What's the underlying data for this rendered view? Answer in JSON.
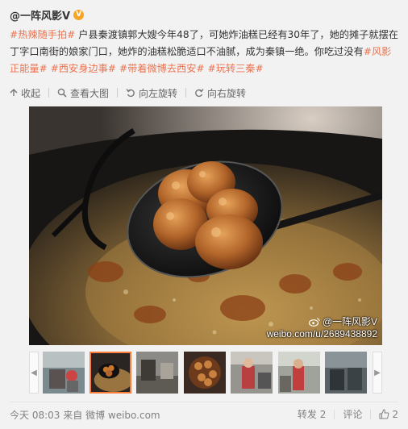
{
  "post": {
    "author": "@一阵风影V",
    "text_segments": [
      {
        "text": "#热辣随手拍#",
        "tag": true
      },
      {
        "text": " 户县秦渡镇郭大嫂今年48了，可她炸油糕已经有30年了，她的摊子就摆在丁字口南街的娘家门口，她炸的油糕松脆适口不油腻，成为秦镇一绝。你吃过没有",
        "tag": false
      },
      {
        "text": "#风影正能量#",
        "tag": true
      },
      {
        "text": " ",
        "tag": false
      },
      {
        "text": "#西安身边事#",
        "tag": true
      },
      {
        "text": " ",
        "tag": false
      },
      {
        "text": "#带着微博去西安#",
        "tag": true
      },
      {
        "text": " ",
        "tag": false
      },
      {
        "text": "#玩转三秦#",
        "tag": true
      }
    ]
  },
  "toolbar": {
    "collapse": "收起",
    "view_large": "查看大图",
    "rotate_left": "向左旋转",
    "rotate_right": "向右旋转"
  },
  "photo": {
    "watermark_user": "@一阵风影V",
    "watermark_url": "weibo.com/u/2689438892"
  },
  "thumbnails": {
    "count": 7,
    "selected_index": 1,
    "icons": [
      "chevron-left-icon",
      "chevron-right-icon"
    ]
  },
  "footer": {
    "time": "今天 08:03",
    "source_prefix": "来自",
    "source": "微博 weibo.com",
    "repost_label": "转发",
    "repost_count": "2",
    "comment_label": "评论",
    "like_count": "2"
  },
  "colors": {
    "tag": "#eb7350",
    "badge": "#f6a623",
    "active_thumb": "#fa7d3c"
  }
}
